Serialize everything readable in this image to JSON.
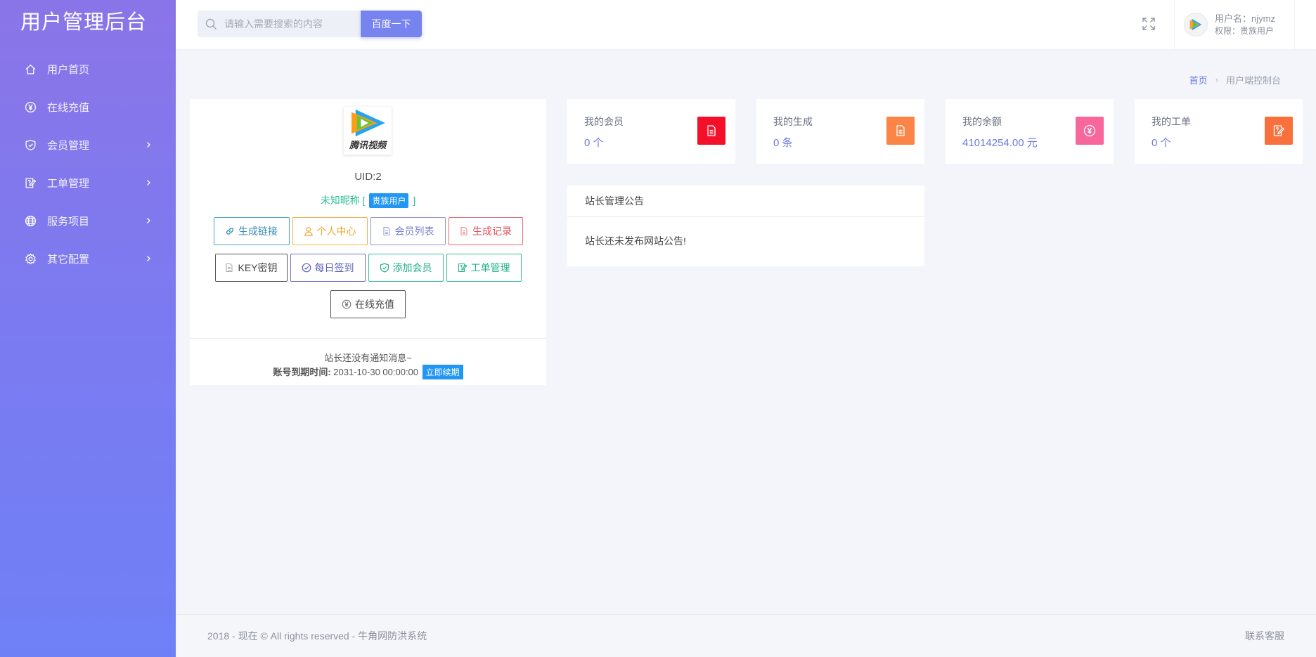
{
  "brand": {
    "title": "用户管理后台"
  },
  "sidebar": {
    "items": [
      {
        "label": "用户首页",
        "icon": "home-icon",
        "has_arrow": false
      },
      {
        "label": "在线充值",
        "icon": "yuan-icon",
        "has_arrow": false
      },
      {
        "label": "会员管理",
        "icon": "shield-icon",
        "has_arrow": true
      },
      {
        "label": "工单管理",
        "icon": "ticket-edit-icon",
        "has_arrow": true
      },
      {
        "label": "服务项目",
        "icon": "globe-icon",
        "has_arrow": true
      },
      {
        "label": "其它配置",
        "icon": "gear-icon",
        "has_arrow": true
      }
    ]
  },
  "header": {
    "search": {
      "placeholder": "请输入需要搜索的内容",
      "value": ""
    },
    "search_button": "百度一下",
    "user": {
      "name": "用户名：njymz",
      "role": "权限：贵族用户"
    }
  },
  "breadcrumb": {
    "home": "首页",
    "current": "用户端控制台"
  },
  "profile": {
    "logo_text": "腾讯视频",
    "uid": "UID:2",
    "nickname_prefix": "未知昵称 [",
    "badge": "贵族用户",
    "nickname_suffix": "]",
    "buttons_row1": [
      {
        "label": "生成链接",
        "icon": "link-icon"
      },
      {
        "label": "个人中心",
        "icon": "user-icon"
      },
      {
        "label": "会员列表",
        "icon": "document-icon"
      },
      {
        "label": "生成记录",
        "icon": "document-icon"
      }
    ],
    "buttons_row2": [
      {
        "label": "KEY密钥",
        "icon": "document-icon"
      },
      {
        "label": "每日签到",
        "icon": "check-circle-icon"
      },
      {
        "label": "添加会员",
        "icon": "shield-check-icon"
      },
      {
        "label": "工单管理",
        "icon": "ticket-edit-icon"
      }
    ],
    "buttons_row3": [
      {
        "label": "在线充值",
        "icon": "yuan-icon"
      }
    ],
    "notice": "站长还没有通知消息~",
    "expire_label": "账号到期时间:",
    "expire_value": "2031-10-30 00:00:00",
    "renew_label": "立即续期"
  },
  "stats": [
    {
      "title": "我的会员",
      "value": "0 个",
      "color": "#f5102a",
      "icon": "document-icon"
    },
    {
      "title": "我的生成",
      "value": "0 条",
      "color": "#fa8547",
      "icon": "document-icon"
    },
    {
      "title": "我的余额",
      "value": "41014254.00 元",
      "color": "#f7679c",
      "icon": "yuan-icon"
    },
    {
      "title": "我的工单",
      "value": "0 个",
      "color": "#f9703d",
      "icon": "ticket-edit-icon"
    }
  ],
  "announcement": {
    "title": "站长管理公告",
    "body": "站长还未发布网站公告!"
  },
  "footer": {
    "copyright": "2018 - 现在 © All rights reserved - 牛角网防洪系统",
    "service": "联系客服"
  }
}
